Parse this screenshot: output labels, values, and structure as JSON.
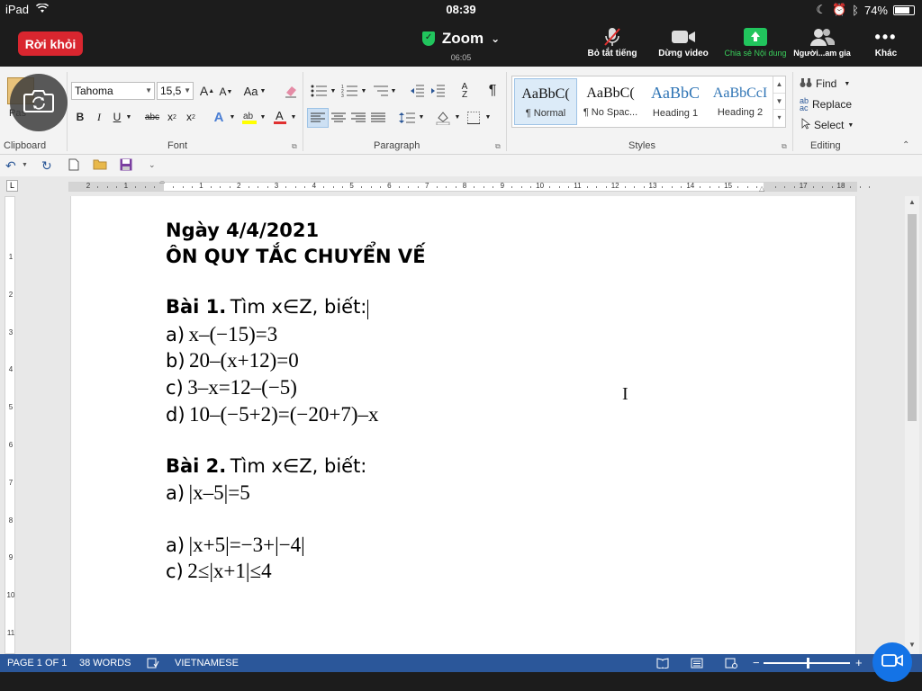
{
  "ipad_status": {
    "device": "iPad",
    "time": "08:39",
    "battery": "74%"
  },
  "zoom": {
    "leave_label": "Rời khỏi",
    "app_title": "Zoom",
    "timer": "06:05",
    "buttons": {
      "mute": "Bỏ tắt tiếng",
      "video": "Dừng video",
      "share": "Chia sẻ Nội dung",
      "participants": "Người...am gia",
      "more": "Khác"
    }
  },
  "ribbon": {
    "clipboard": {
      "paste": "Pas",
      "label": "Clipboard"
    },
    "font": {
      "label": "Font",
      "font_name": "Tahoma",
      "font_size": "15,5",
      "grow": "A",
      "shrink": "A",
      "case": "Aa",
      "bold": "B",
      "italic": "I",
      "underline": "U",
      "strike": "abc",
      "subscript": "x",
      "superscript": "x",
      "highlight_color": "#ffff00",
      "font_color": "#e03030"
    },
    "paragraph": {
      "label": "Paragraph"
    },
    "styles": {
      "label": "Styles",
      "items": [
        {
          "sample": "AaBbC(",
          "name": "¶ Normal"
        },
        {
          "sample": "AaBbC(",
          "name": "¶ No Spac..."
        },
        {
          "sample": "AaBbC",
          "name": "Heading 1"
        },
        {
          "sample": "AaBbCcI",
          "name": "Heading 2"
        }
      ]
    },
    "editing": {
      "label": "Editing",
      "find": "Find",
      "replace": "Replace",
      "select": "Select"
    }
  },
  "ruler": {
    "h_ticks": [
      "2",
      "1",
      "",
      "1",
      "2",
      "3",
      "4",
      "5",
      "6",
      "7",
      "8",
      "9",
      "10",
      "11",
      "12",
      "13",
      "14",
      "15",
      "",
      "17",
      "18"
    ],
    "v_ticks": [
      "1",
      "2",
      "3",
      "4",
      "5",
      "6",
      "7",
      "8",
      "9",
      "10",
      "11"
    ]
  },
  "document": {
    "date": "Ngày 4/4/2021",
    "topic": "ÔN QUY TẮC CHUYỂN VẾ",
    "ex1": {
      "title": "Bài 1.",
      "prompt": "Tìm x∈Z, biết:",
      "items": [
        {
          "label": "a)",
          "expr": "x–(−15)=3"
        },
        {
          "label": "b)",
          "expr": "20–(x+12)=0"
        },
        {
          "label": "c)",
          "expr": "3–x=12–(−5)"
        },
        {
          "label": "d)",
          "expr": "10–(−5+2)=(−20+7)–x"
        }
      ]
    },
    "ex2": {
      "title": "Bài 2.",
      "prompt": "Tìm x∈Z, biết:",
      "items": [
        {
          "label": "a)",
          "expr": "|x–5|=5"
        },
        {
          "label": "a)",
          "expr": "|x+5|=−3+|−4|"
        },
        {
          "label": "c)",
          "expr": "2≤|x+1|≤4"
        }
      ]
    }
  },
  "statusbar": {
    "page": "PAGE 1 OF 1",
    "words": "38 WORDS",
    "language": "VIETNAMESE",
    "zoom_minus": "−",
    "zoom_plus": "+"
  }
}
